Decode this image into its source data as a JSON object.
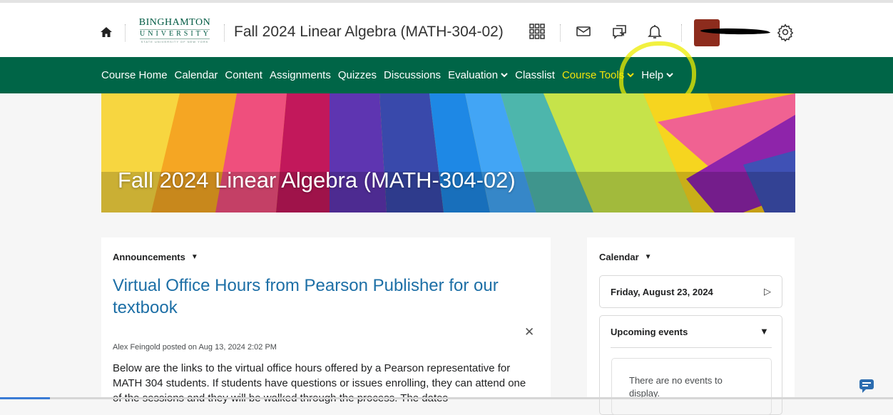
{
  "header": {
    "logo": {
      "line1": "BINGHAMTON",
      "line2": "UNIVERSITY",
      "line3": "STATE UNIVERSITY OF NEW YORK"
    },
    "course_title": "Fall 2024 Linear Algebra (MATH-304-02)",
    "icons": [
      "home-icon",
      "waffle-icon",
      "mail-icon",
      "chat-icon",
      "bell-icon",
      "gear-icon"
    ]
  },
  "nav": {
    "items": [
      {
        "label": "Course Home",
        "has_menu": false
      },
      {
        "label": "Calendar",
        "has_menu": false
      },
      {
        "label": "Content",
        "has_menu": false
      },
      {
        "label": "Assignments",
        "has_menu": false
      },
      {
        "label": "Quizzes",
        "has_menu": false
      },
      {
        "label": "Discussions",
        "has_menu": false
      },
      {
        "label": "Evaluation",
        "has_menu": true
      },
      {
        "label": "Classlist",
        "has_menu": false
      },
      {
        "label": "Course Tools",
        "has_menu": true,
        "active": true
      },
      {
        "label": "Help",
        "has_menu": true
      }
    ],
    "chevron": "⌄",
    "colors": {
      "background": "#006547",
      "text": "#ffffff",
      "active_text": "#f4e30a",
      "annotation": "#eeec00"
    }
  },
  "banner": {
    "title": "Fall 2024 Linear Algebra (MATH-304-02)"
  },
  "announcements": {
    "widget_title": "Announcements",
    "heading": "Virtual Office Hours from Pearson Publisher for our textbook",
    "meta": "Alex Feingold posted on Aug 13, 2024 2:02 PM",
    "body": "Below are the links to the virtual office hours offered by a Pearson representative for MATH 304 students. If students have questions or issues enrolling, they can attend one of the sessions and they will be walked through the process. The dates"
  },
  "calendar": {
    "widget_title": "Calendar",
    "date": "Friday, August 23, 2024",
    "upcoming_label": "Upcoming events",
    "empty_text": "There are no events to display."
  }
}
